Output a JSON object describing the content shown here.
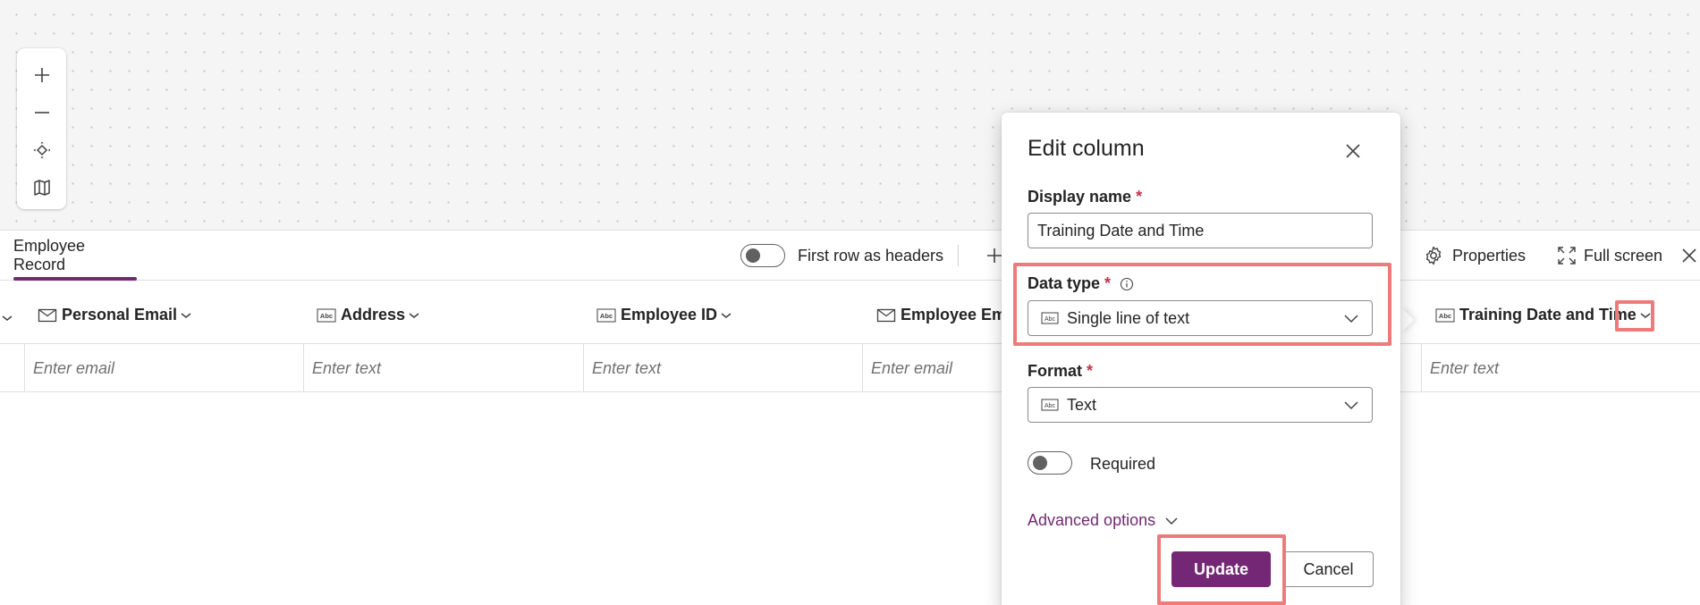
{
  "canvas": {
    "zoom_controls": [
      {
        "name": "zoom-in-icon"
      },
      {
        "name": "zoom-out-icon"
      },
      {
        "name": "fit-view-icon"
      },
      {
        "name": "map-icon"
      }
    ]
  },
  "tabbar": {
    "active_tab": "Employee Record",
    "first_row_toggle_label": "First row as headers",
    "properties_label": "Properties",
    "fullscreen_label": "Full screen"
  },
  "columns": [
    {
      "title": "Personal Email",
      "icon": "mail-icon",
      "placeholder": "Enter email"
    },
    {
      "title": "Address",
      "icon": "text-abc-icon",
      "placeholder": "Enter text"
    },
    {
      "title": "Employee ID",
      "icon": "text-abc-icon",
      "placeholder": "Enter text"
    },
    {
      "title": "Employee Ema",
      "icon": "mail-icon",
      "placeholder": "Enter email"
    },
    {
      "title": "Training Date and Time",
      "icon": "text-abc-icon",
      "placeholder": "Enter text"
    }
  ],
  "dialog": {
    "title": "Edit column",
    "display_name_label": "Display name",
    "display_name_value": "Training Date and Time",
    "data_type_label": "Data type",
    "data_type_value": "Single line of text",
    "format_label": "Format",
    "format_value": "Text",
    "required_label": "Required",
    "required_on": false,
    "advanced_label": "Advanced options",
    "update_label": "Update",
    "cancel_label": "Cancel",
    "required_marker": "*"
  },
  "colors": {
    "accent": "#742774",
    "highlight": "#ee7a7a",
    "required": "#c4314b"
  }
}
